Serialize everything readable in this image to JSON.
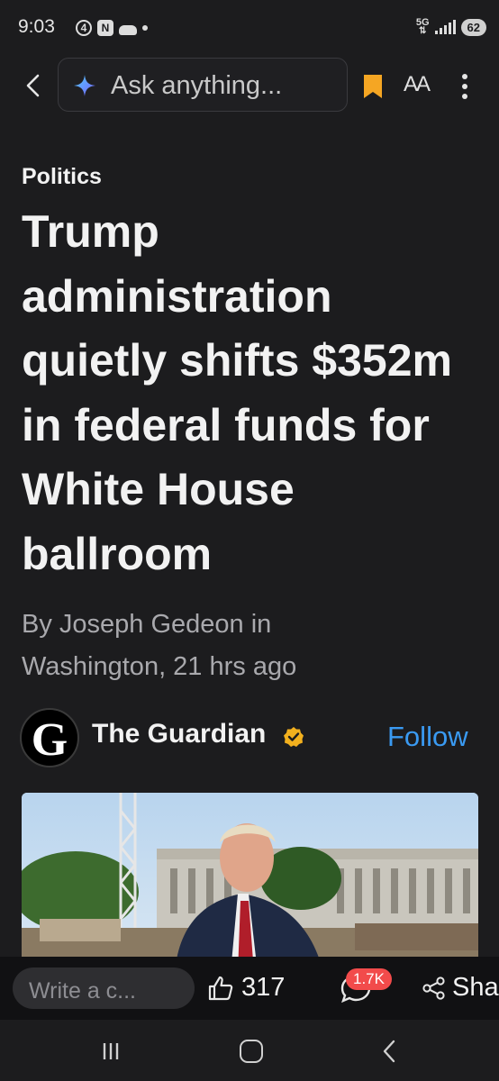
{
  "status_bar": {
    "time": "9:03",
    "notif_badge": "4",
    "network": "5G",
    "battery": "62"
  },
  "top_bar": {
    "search_placeholder": "Ask anything...",
    "text_size_label": "AA",
    "bookmark_color": "#f5a623"
  },
  "article": {
    "category": "Politics",
    "headline": "Trump administration quietly shifts $352m in federal funds for White House ballroom",
    "byline": "By Joseph Gedeon in Washington,  21 hrs ago"
  },
  "source": {
    "logo_letter": "G",
    "name": "The Guardian",
    "follow_label": "Follow",
    "accent_color": "#3a9af2"
  },
  "action_bar": {
    "comment_placeholder": "Write a c...",
    "like_count": "317",
    "comment_count": "1.7K",
    "share_label": "Sha"
  }
}
